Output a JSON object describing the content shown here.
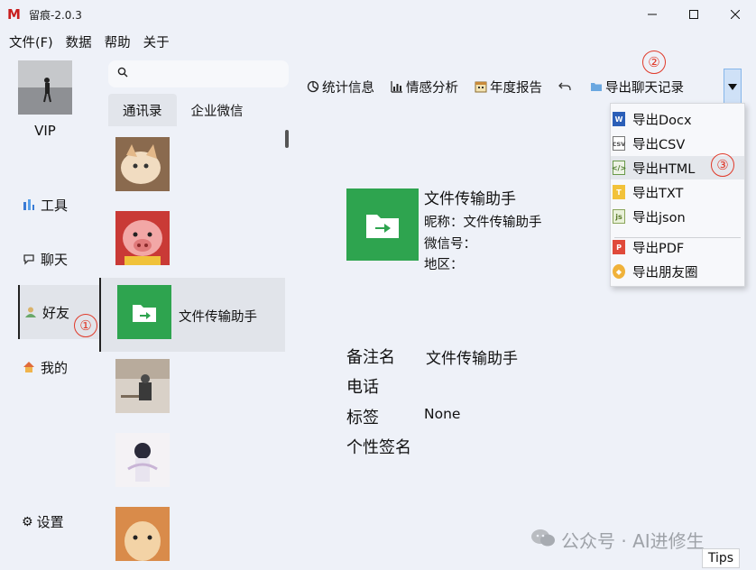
{
  "window": {
    "title": "留痕-2.0.3",
    "logo": "M"
  },
  "menu": [
    "文件(F)",
    "数据",
    "帮助",
    "关于"
  ],
  "nav": {
    "vip": "VIP",
    "items": [
      {
        "label": "工具",
        "icon": "chart-icon"
      },
      {
        "label": "聊天",
        "icon": "chat-icon"
      },
      {
        "label": "好友",
        "icon": "user-icon"
      },
      {
        "label": "我的",
        "icon": "home-icon"
      }
    ],
    "settings": "设置"
  },
  "search": {
    "placeholder": ""
  },
  "contact_tabs": [
    "通讯录",
    "企业微信"
  ],
  "contacts": [
    {
      "name": ""
    },
    {
      "name": ""
    },
    {
      "name": "文件传输助手"
    },
    {
      "name": ""
    },
    {
      "name": ""
    },
    {
      "name": ""
    }
  ],
  "toolbar": {
    "stats": "统计信息",
    "sentiment": "情感分析",
    "annual": "年度报告",
    "export_chat": "导出聊天记录"
  },
  "export_menu": [
    "导出Docx",
    "导出CSV",
    "导出HTML",
    "导出TXT",
    "导出json",
    "导出PDF",
    "导出朋友圈"
  ],
  "markers": [
    "①",
    "②",
    "③"
  ],
  "detail": {
    "name": "文件传输助手",
    "nickname": "昵称：文件传输助手",
    "wxid": "微信号：",
    "region": "地区：",
    "remark_label": "备注名",
    "remark_value": "文件传输助手",
    "phone_label": "电话",
    "tag_label": "标签",
    "tag_value": "None",
    "signature_label": "个性签名"
  },
  "watermark": "公众号 · AI进修生",
  "tips": "Tips",
  "colors": {
    "accent_green": "#2ea44f",
    "marker_red": "#e03a2a",
    "dropdown_blue": "#cfe1f7"
  }
}
